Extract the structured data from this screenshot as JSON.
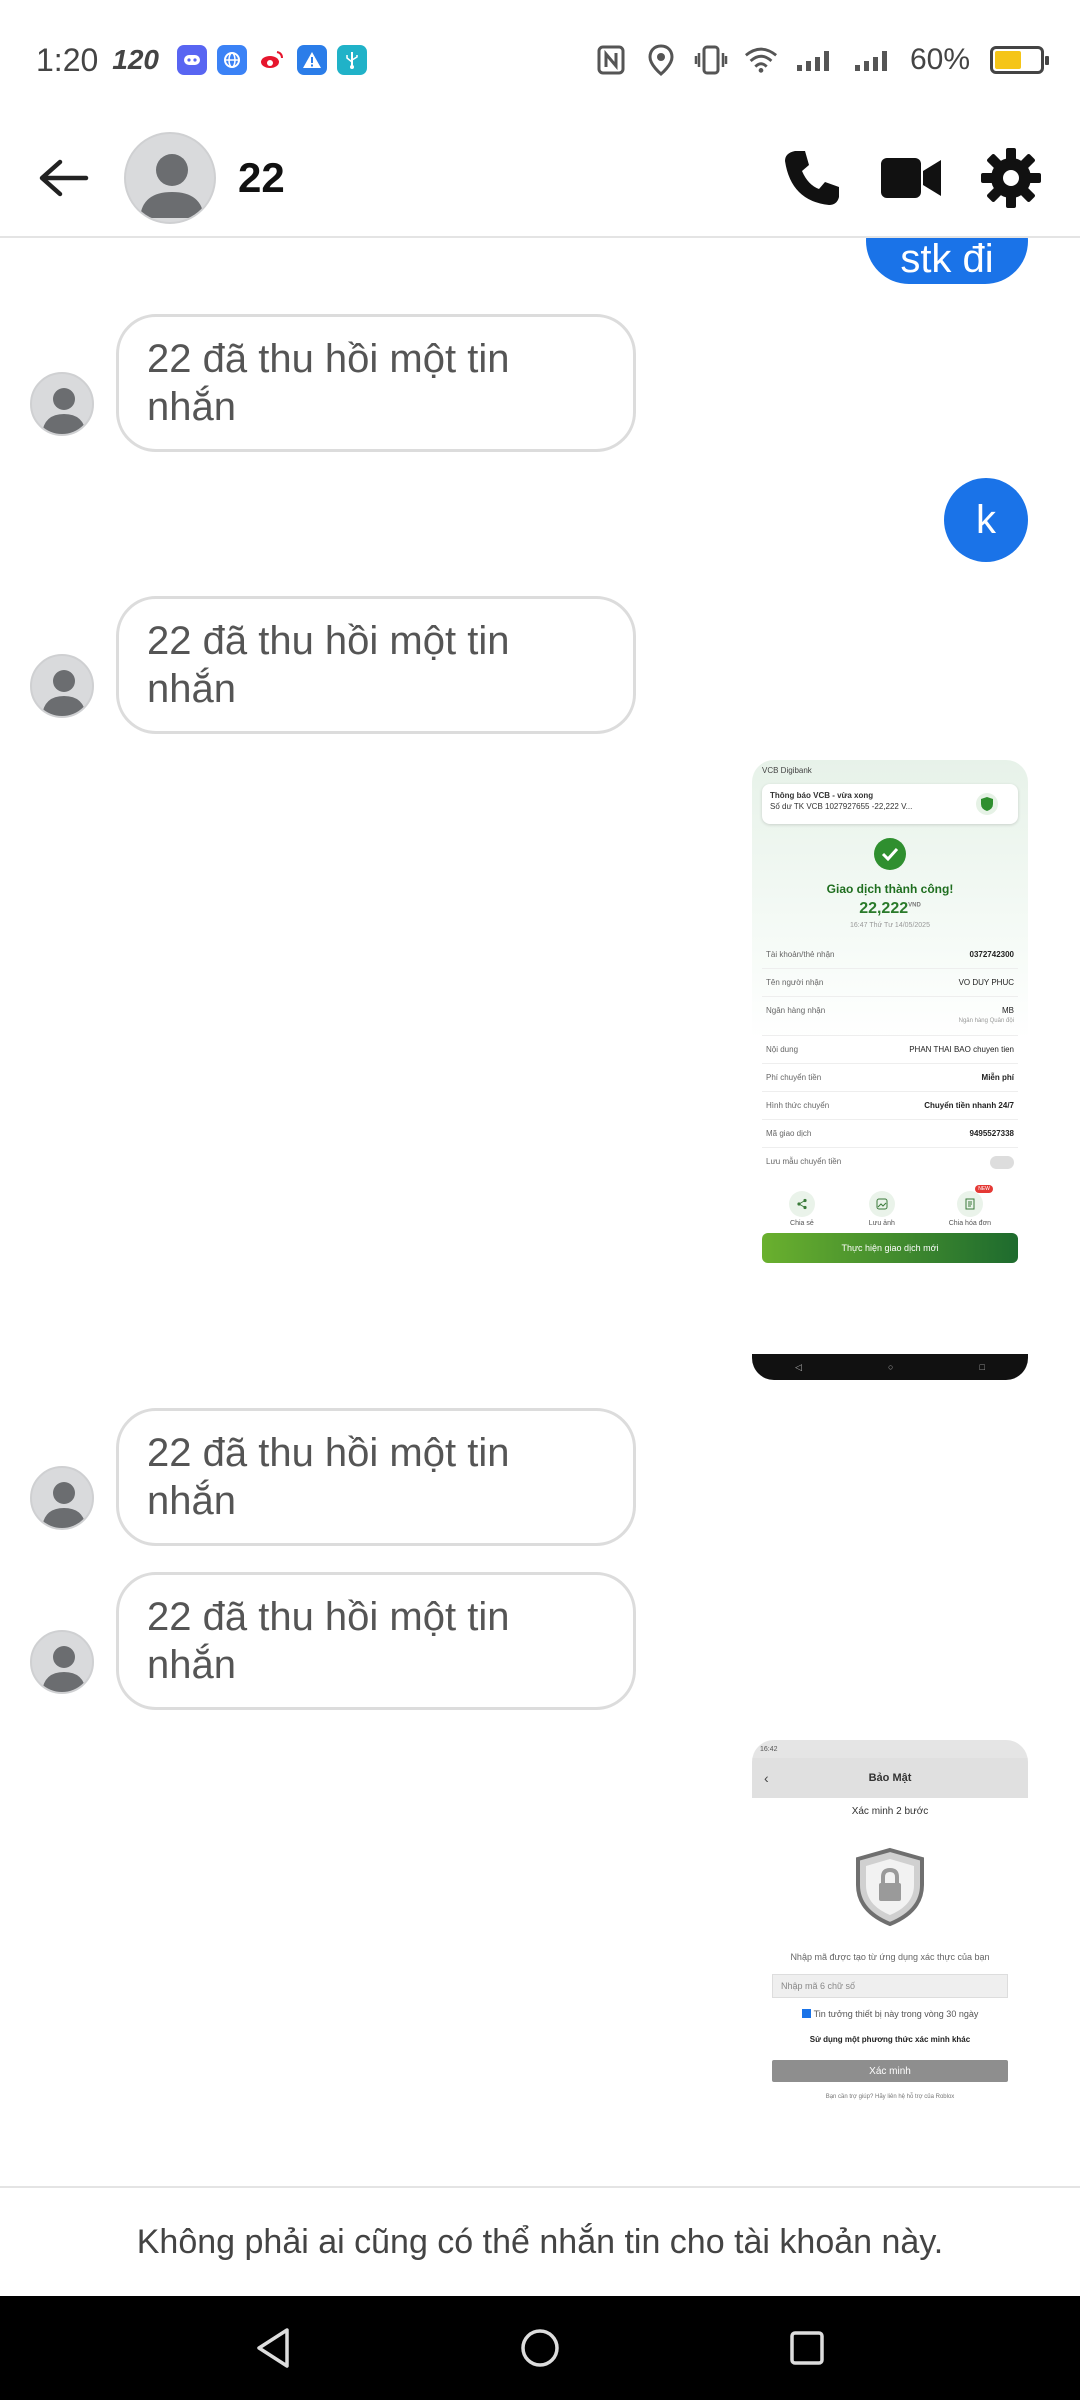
{
  "status_bar": {
    "time": "1:20",
    "refresh_rate": "120",
    "battery_percent": "60%",
    "battery_level": 0.6
  },
  "header": {
    "contact_name": "22"
  },
  "messages": {
    "out_partial": "stk đi",
    "out_k": "k",
    "recalled_text": "22 đã thu hồi một tin nhắn"
  },
  "vcb_receipt": {
    "app_name": "VCB Digibank",
    "notif_title": "Thông báo VCB - vừa xong",
    "notif_body": "Số dư TK VCB 1027927655 -22,222 V...",
    "status": "Giao dịch thành công!",
    "amount": "22,222",
    "currency": "VND",
    "time": "16:47 Thứ Tư 14/05/2025",
    "rows": [
      {
        "label": "Tài khoản/thẻ nhận",
        "value": "0372742300"
      },
      {
        "label": "Tên người nhận",
        "value": "VO DUY PHUC"
      },
      {
        "label": "Ngân hàng nhận",
        "value": "MB"
      },
      {
        "label": "Nội dung",
        "value": "PHAN THAI BAO chuyen tien"
      },
      {
        "label": "Phí chuyển tiền",
        "value": "Miễn phí"
      },
      {
        "label": "Hình thức chuyển",
        "value": "Chuyển tiền nhanh 24/7"
      },
      {
        "label": "Mã giao dịch",
        "value": "9495527338"
      }
    ],
    "bank_sub": "Ngân hàng Quân đội",
    "save_template": "Lưu mẫu chuyển tiền",
    "actions": [
      "Chia sẻ",
      "Lưu ảnh",
      "Chia hóa đơn"
    ],
    "new_badge": "NEW",
    "new_tx_button": "Thực hiện giao dịch mới"
  },
  "security_screen": {
    "time": "16:42",
    "title": "Bảo Mật",
    "subtitle": "Xác minh 2 bước",
    "description": "Nhập mã được tạo từ ứng dụng xác thực của bạn",
    "input_placeholder": "Nhập mã 6 chữ số",
    "trust_device": "Tin tưởng thiết bị này trong vòng 30 ngày",
    "alt_method": "Sử dụng một phương thức xác minh khác",
    "verify_button": "Xác minh",
    "footer": "Bạn cần trợ giúp? Hãy liên hệ hỗ trợ của Roblox"
  },
  "footer": {
    "notice": "Không phải ai cũng có thể nhắn tin cho tài khoản này."
  }
}
